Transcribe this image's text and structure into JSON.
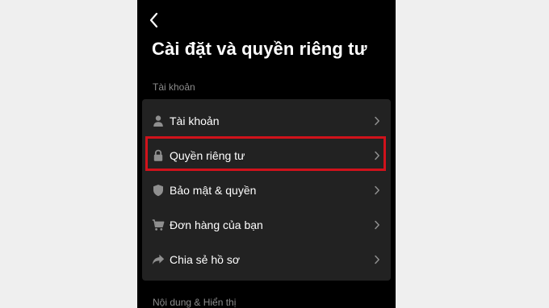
{
  "header": {
    "back_icon": "chevron-left-icon",
    "title": "Cài đặt và quyền riêng tư"
  },
  "sections": [
    {
      "label": "Tài khoản",
      "items": [
        {
          "icon": "person-icon",
          "label": "Tài khoản"
        },
        {
          "icon": "lock-icon",
          "label": "Quyền riêng tư",
          "highlighted": true
        },
        {
          "icon": "shield-icon",
          "label": "Bảo mật & quyền"
        },
        {
          "icon": "cart-icon",
          "label": "Đơn hàng của bạn"
        },
        {
          "icon": "share-icon",
          "label": "Chia sẻ hồ sơ"
        }
      ]
    },
    {
      "label": "Nội dung & Hiển thị"
    }
  ],
  "colors": {
    "background": "#000000",
    "card": "#222222",
    "text": "#ffffff",
    "muted_text": "#8c8c8c",
    "highlight": "#d0121b",
    "outer_background": "#efefef"
  }
}
